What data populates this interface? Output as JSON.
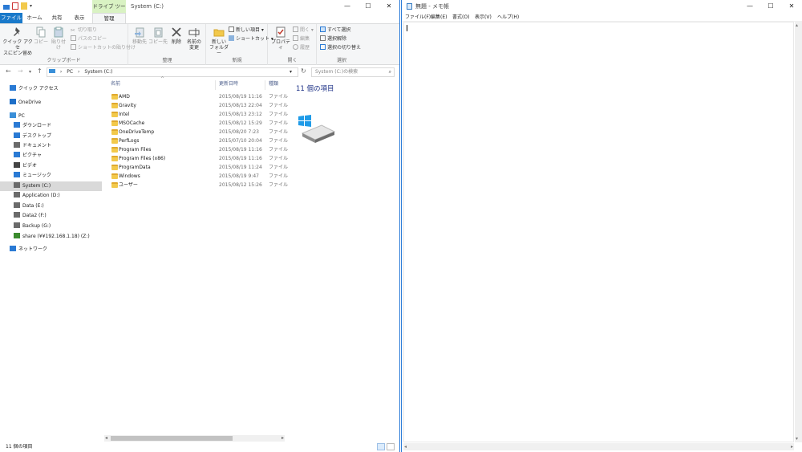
{
  "explorer": {
    "title": "System (C:)",
    "contextual_tab_group": "ドライブ ツール",
    "tabs": [
      {
        "label": "ファイル"
      },
      {
        "label": "ホーム"
      },
      {
        "label": "共有"
      },
      {
        "label": "表示"
      },
      {
        "label": "管理"
      }
    ],
    "ribbon": {
      "clipboard": {
        "label": "クリップボード",
        "pin": "クイック アクセスにピン留め",
        "pin_line1": "クイック アクセ",
        "pin_line2": "スにピン留め",
        "copy": "コピー",
        "paste": "貼り付け",
        "cut": "切り取り",
        "copy_path": "パスのコピー",
        "paste_shortcut": "ショートカットの貼り付け"
      },
      "organize": {
        "label": "整理",
        "move_to": "移動先",
        "copy_to": "コピー先",
        "delete": "削除",
        "rename_line1": "名前の",
        "rename_line2": "変更"
      },
      "new": {
        "label": "新規",
        "new_folder_line1": "新しい",
        "new_folder_line2": "フォルダー",
        "new_item": "新しい項目 ▾",
        "shortcut": "ショートカット ▾"
      },
      "open": {
        "label": "開く",
        "properties": "プロパティ",
        "open": "開く ▾",
        "edit": "編集",
        "history": "履歴"
      },
      "select": {
        "label": "選択",
        "select_all": "すべて選択",
        "select_none": "選択解除",
        "invert": "選択の切り替え"
      }
    },
    "address": {
      "crumbs": [
        "PC",
        "System (C:)"
      ],
      "search_placeholder": "System (C:)の検索"
    },
    "nav": [
      {
        "label": "クイック アクセス",
        "icon": "star-icon",
        "color": "#2a7ad4"
      },
      {
        "label": "OneDrive",
        "icon": "cloud-icon",
        "color": "#1e6fc8"
      },
      {
        "label": "PC",
        "icon": "computer-icon",
        "color": "#3a8fd8"
      },
      {
        "label": "ダウンロード",
        "icon": "download-arrow-icon",
        "color": "#2a7ad4"
      },
      {
        "label": "デスクトップ",
        "icon": "desktop-icon",
        "color": "#2a7ad4"
      },
      {
        "label": "ドキュメント",
        "icon": "document-icon",
        "color": "#6a6a6a"
      },
      {
        "label": "ピクチャ",
        "icon": "pictures-icon",
        "color": "#2a7ad4"
      },
      {
        "label": "ビデオ",
        "icon": "video-icon",
        "color": "#444444"
      },
      {
        "label": "ミュージック",
        "icon": "music-note-icon",
        "color": "#2a7ad4"
      },
      {
        "label": "System (C:)",
        "icon": "drive-icon",
        "color": "#6b6b6b"
      },
      {
        "label": "Application (D:)",
        "icon": "drive-icon",
        "color": "#6b6b6b"
      },
      {
        "label": "Data (E:)",
        "icon": "drive-icon",
        "color": "#6b6b6b"
      },
      {
        "label": "Data2 (F:)",
        "icon": "drive-icon",
        "color": "#6b6b6b"
      },
      {
        "label": "Backup (G:)",
        "icon": "drive-icon",
        "color": "#6b6b6b"
      },
      {
        "label": "share (¥¥192.168.1.18) (Z:)",
        "icon": "network-drive-icon",
        "color": "#3b8b2e"
      },
      {
        "label": "ネットワーク",
        "icon": "network-icon",
        "color": "#2a7ad4"
      }
    ],
    "columns": {
      "name": "名前",
      "date": "更新日時",
      "type": "種類"
    },
    "files": [
      {
        "name": "AMD",
        "date": "2015/08/19 11:16",
        "type": "ファイル"
      },
      {
        "name": "Gravity",
        "date": "2015/08/13 22:04",
        "type": "ファイル"
      },
      {
        "name": "Intel",
        "date": "2015/08/13 23:12",
        "type": "ファイル"
      },
      {
        "name": "MSOCache",
        "date": "2015/08/12 15:29",
        "type": "ファイル"
      },
      {
        "name": "OneDriveTemp",
        "date": "2015/08/20 7:23",
        "type": "ファイル"
      },
      {
        "name": "PerfLogs",
        "date": "2015/07/10 20:04",
        "type": "ファイル"
      },
      {
        "name": "Program Files",
        "date": "2015/08/19 11:16",
        "type": "ファイル"
      },
      {
        "name": "Program Files (x86)",
        "date": "2015/08/19 11:16",
        "type": "ファイル"
      },
      {
        "name": "ProgramData",
        "date": "2015/08/19 11:24",
        "type": "ファイル"
      },
      {
        "name": "Windows",
        "date": "2015/08/19 9:47",
        "type": "ファイル"
      },
      {
        "name": "ユーザー",
        "date": "2015/08/12 15:26",
        "type": "ファイル"
      }
    ],
    "preview_title": "11 個の項目",
    "status": "11 個の項目"
  },
  "notepad": {
    "title": "無題 - メモ帳",
    "menu": [
      "ファイル(F)",
      "編集(E)",
      "書式(O)",
      "表示(V)",
      "ヘルプ(H)"
    ]
  },
  "colors": {
    "accent": "#1979ca",
    "folder": "#f2c94c",
    "selected": "#d9d9d9"
  }
}
